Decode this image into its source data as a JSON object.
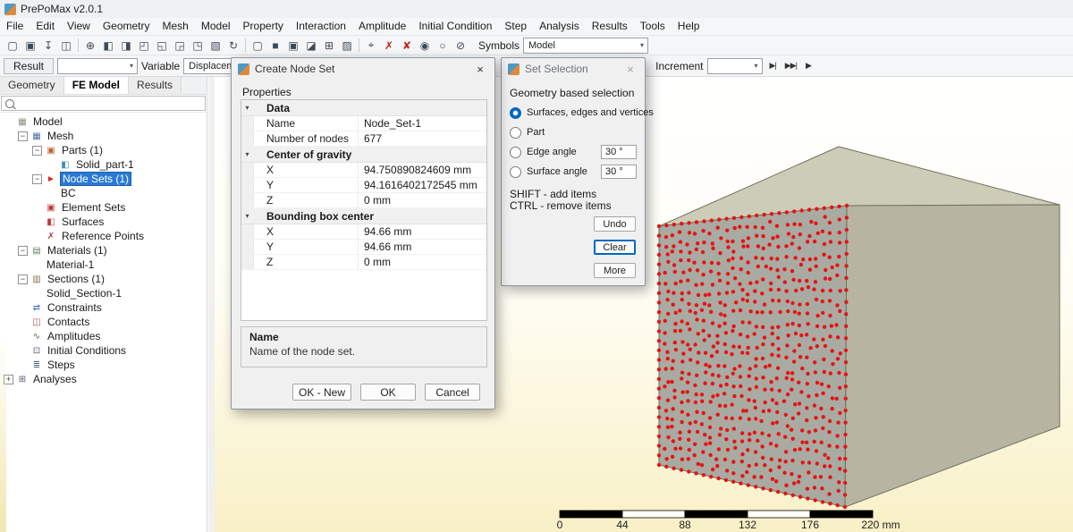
{
  "window": {
    "title": "PrePoMax v2.0.1"
  },
  "ui": {
    "dropdown_arrow": "▾",
    "accent_color": "#0067c0"
  },
  "menu": {
    "items": [
      "File",
      "Edit",
      "View",
      "Geometry",
      "Mesh",
      "Model",
      "Property",
      "Interaction",
      "Amplitude",
      "Initial Condition",
      "Step",
      "Analysis",
      "Results",
      "Tools",
      "Help"
    ]
  },
  "toolbar_main": {
    "groups": [
      {
        "icons": [
          {
            "name": "new-model-icon",
            "glyph": "▢"
          },
          {
            "name": "open-file-icon",
            "glyph": "▣"
          },
          {
            "name": "import-file-icon",
            "glyph": "↧"
          },
          {
            "name": "save-file-icon",
            "glyph": "◫"
          }
        ]
      },
      {
        "icons": [
          {
            "name": "zoom-to-fit-icon",
            "glyph": "⊕"
          },
          {
            "name": "view-front-icon",
            "glyph": "◧"
          },
          {
            "name": "view-back-icon",
            "glyph": "◨"
          },
          {
            "name": "view-top-icon",
            "glyph": "◰"
          },
          {
            "name": "view-bottom-icon",
            "glyph": "◱"
          },
          {
            "name": "view-left-icon",
            "glyph": "◲"
          },
          {
            "name": "view-right-icon",
            "glyph": "◳"
          },
          {
            "name": "view-isometric-icon",
            "glyph": "▧"
          },
          {
            "name": "rotate-view-icon",
            "glyph": "↻"
          }
        ]
      },
      {
        "icons": [
          {
            "name": "wireframe-view-icon",
            "glyph": "▢"
          },
          {
            "name": "solid-view-icon",
            "glyph": "■"
          },
          {
            "name": "solid-with-edges-view-icon",
            "glyph": "▣"
          },
          {
            "name": "section-view-icon",
            "glyph": "◪"
          },
          {
            "name": "exploded-view-icon",
            "glyph": "⊞"
          },
          {
            "name": "transparent-view-icon",
            "glyph": "▨"
          }
        ]
      },
      {
        "icons": [
          {
            "name": "query-icon",
            "glyph": "⌖"
          },
          {
            "name": "remove-selection-icon",
            "glyph": "✗",
            "color": "#c22222"
          },
          {
            "name": "clear-all-selection-icon",
            "glyph": "✘",
            "color": "#c22222"
          },
          {
            "name": "show-hide-icon",
            "glyph": "◉"
          },
          {
            "name": "highlight-icon",
            "glyph": "○"
          },
          {
            "name": "filter-icon",
            "glyph": "⊘"
          }
        ]
      }
    ],
    "symbols_label": "Symbols",
    "symbols_value": "Model"
  },
  "toolbar_results": {
    "result_label": "Result",
    "result_value": "",
    "variable_label": "Variable",
    "variable_value": "Displaceme",
    "increment_label": "Increment",
    "increment_value": "",
    "media_buttons": [
      {
        "name": "first-increment-button",
        "glyph": "▶|"
      },
      {
        "name": "last-increment-button",
        "glyph": "▶▶|"
      },
      {
        "name": "animate-button",
        "glyph": "▶"
      }
    ]
  },
  "tabs": {
    "items": [
      {
        "label": "Geometry",
        "active": false
      },
      {
        "label": "FE Model",
        "active": true
      },
      {
        "label": "Results",
        "active": false
      }
    ]
  },
  "tree": {
    "expander_minus": "−",
    "expander_plus": "+",
    "items": [
      {
        "depth": 0,
        "expander": null,
        "icon": "model-icon",
        "glyph": "▦",
        "color": "#8a8a7a",
        "label": "Model"
      },
      {
        "depth": 1,
        "expander": "minus",
        "icon": "mesh-icon",
        "glyph": "▦",
        "color": "#4a6fa5",
        "label": "Mesh"
      },
      {
        "depth": 2,
        "expander": "minus",
        "icon": "parts-icon",
        "glyph": "▣",
        "color": "#c0622e",
        "label": "Parts (1)"
      },
      {
        "depth": 3,
        "expander": null,
        "icon": "part-icon",
        "glyph": "◧",
        "color": "#3f93bb",
        "label": "Solid_part-1"
      },
      {
        "depth": 2,
        "expander": "minus",
        "icon": "node-sets-icon",
        "glyph": "►",
        "color": "#d42a2a",
        "label": "Node Sets (1)",
        "selected": true
      },
      {
        "depth": 3,
        "expander": null,
        "icon": null,
        "label": "BC"
      },
      {
        "depth": 2,
        "expander": null,
        "icon": "element-sets-icon",
        "glyph": "▣",
        "color": "#c03a3a",
        "label": "Element Sets"
      },
      {
        "depth": 2,
        "expander": null,
        "icon": "surfaces-icon",
        "glyph": "◧",
        "color": "#c03a3a",
        "label": "Surfaces"
      },
      {
        "depth": 2,
        "expander": null,
        "icon": "reference-points-icon",
        "glyph": "✗",
        "color": "#b04040",
        "label": "Reference Points"
      },
      {
        "depth": 1,
        "expander": "minus",
        "icon": "materials-icon",
        "glyph": "▤",
        "color": "#5f8a5f",
        "label": "Materials (1)"
      },
      {
        "depth": 2,
        "expander": null,
        "icon": null,
        "label": "Material-1"
      },
      {
        "depth": 1,
        "expander": "minus",
        "icon": "sections-icon",
        "glyph": "▥",
        "color": "#8a6f4f",
        "label": "Sections (1)"
      },
      {
        "depth": 2,
        "expander": null,
        "icon": null,
        "label": "Solid_Section-1"
      },
      {
        "depth": 1,
        "expander": null,
        "icon": "constraints-icon",
        "glyph": "⇄",
        "color": "#3b66c4",
        "label": "Constraints"
      },
      {
        "depth": 1,
        "expander": null,
        "icon": "contacts-icon",
        "glyph": "◫",
        "color": "#b05555",
        "label": "Contacts"
      },
      {
        "depth": 1,
        "expander": null,
        "icon": "amplitudes-icon",
        "glyph": "∿",
        "color": "#556070",
        "label": "Amplitudes"
      },
      {
        "depth": 1,
        "expander": null,
        "icon": "initial-conditions-icon",
        "glyph": "⊡",
        "color": "#556070",
        "label": "Initial Conditions"
      },
      {
        "depth": 1,
        "expander": null,
        "icon": "steps-icon",
        "glyph": "≣",
        "color": "#556070",
        "label": "Steps"
      },
      {
        "depth": 0,
        "expander": "plus",
        "icon": "analyses-icon",
        "glyph": "⊞",
        "color": "#556070",
        "label": "Analyses"
      }
    ]
  },
  "dialog_create_node_set": {
    "title": "Create Node Set",
    "close_icon": "×",
    "properties_label": "Properties",
    "grid": {
      "chevron_glyph": "▾",
      "sections": [
        {
          "category": "Data",
          "rows": [
            {
              "label": "Name",
              "value": "Node_Set-1"
            },
            {
              "label": "Number of nodes",
              "value": "677"
            }
          ]
        },
        {
          "category": "Center of gravity",
          "rows": [
            {
              "label": "X",
              "value": "94.750890824609 mm"
            },
            {
              "label": "Y",
              "value": "94.1616402172545 mm"
            },
            {
              "label": "Z",
              "value": "0 mm"
            }
          ]
        },
        {
          "category": "Bounding box center",
          "rows": [
            {
              "label": "X",
              "value": "94.66 mm"
            },
            {
              "label": "Y",
              "value": "94.66 mm"
            },
            {
              "label": "Z",
              "value": "0 mm"
            }
          ]
        }
      ]
    },
    "description": {
      "title": "Name",
      "text": "Name of the node set."
    },
    "buttons": [
      {
        "name": "ok-new-button",
        "label": "OK - New"
      },
      {
        "name": "ok-button",
        "label": "OK"
      },
      {
        "name": "cancel-button",
        "label": "Cancel"
      }
    ]
  },
  "dialog_set_selection": {
    "title": "Set Selection",
    "close_icon": "×",
    "header": "Geometry based selection",
    "radios": [
      {
        "label": "Surfaces, edges and vertices",
        "checked": true
      },
      {
        "label": "Part",
        "checked": false
      },
      {
        "label": "Edge angle",
        "checked": false,
        "value": "30 °"
      },
      {
        "label": "Surface angle",
        "checked": false,
        "value": "30 °"
      }
    ],
    "hints": [
      "SHIFT - add items",
      "CTRL - remove items"
    ],
    "buttons": [
      {
        "name": "undo-button",
        "label": "Undo"
      },
      {
        "name": "clear-button",
        "label": "Clear",
        "focused": true
      },
      {
        "name": "more-button",
        "label": "More"
      }
    ]
  },
  "viewport": {
    "scale_labels": [
      "0",
      "44",
      "88",
      "132",
      "176",
      "220 mm"
    ],
    "node_count": 677,
    "colors": {
      "top_face": "#cdccb6",
      "front_face": "#a9aba2",
      "right_face": "#b7b5a2",
      "edge": "#70705e",
      "node": "#e51414"
    }
  }
}
